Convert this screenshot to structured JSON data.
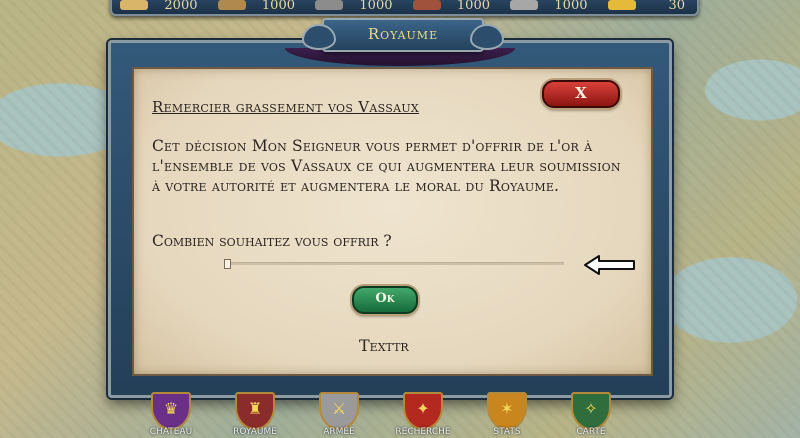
{
  "resources": [
    {
      "value": "2000",
      "icon": "bread-icon",
      "color": "#d9b56a"
    },
    {
      "value": "1000",
      "icon": "wood-icon",
      "color": "#b0894e"
    },
    {
      "value": "1000",
      "icon": "iron-icon",
      "color": "#8c8c8c"
    },
    {
      "value": "1000",
      "icon": "brick-icon",
      "color": "#a0523c"
    },
    {
      "value": "1000",
      "icon": "stone-icon",
      "color": "#a7a7a7"
    },
    {
      "value": "30",
      "icon": "gold-icon",
      "color": "#e5b93a"
    }
  ],
  "dialog": {
    "title": "Royaume",
    "heading": "Remercier grassement vos Vassaux",
    "close_label": "X",
    "body": "Cet décision Mon Seigneur vous permet d'offrir de l'or à l'ensemble de vos Vassaux ce qui augmentera leur soumission à votre autorité et augmentera le moral du Royaume.",
    "question": "Combien souhaitez vous offrir ?",
    "slider_value": 0,
    "ok_label": "Ok",
    "footnote": "Texttr"
  },
  "nav": [
    {
      "label": "CHATEAU",
      "icon": "crown-icon",
      "color": "#6a2f86",
      "glyph": "♛"
    },
    {
      "label": "ROYAUME",
      "icon": "castle-icon",
      "color": "#8a2c2c",
      "glyph": "♜"
    },
    {
      "label": "ARMÉE",
      "icon": "swords-icon",
      "color": "#9a9a9a",
      "glyph": "⚔"
    },
    {
      "label": "RECHERCHE",
      "icon": "book-icon",
      "color": "#b3281f",
      "glyph": "✦"
    },
    {
      "label": "STATS",
      "icon": "eagle-icon",
      "color": "#c9861e",
      "glyph": "✶"
    },
    {
      "label": "CARTE",
      "icon": "compass-icon",
      "color": "#2f6e3c",
      "glyph": "✧"
    }
  ]
}
